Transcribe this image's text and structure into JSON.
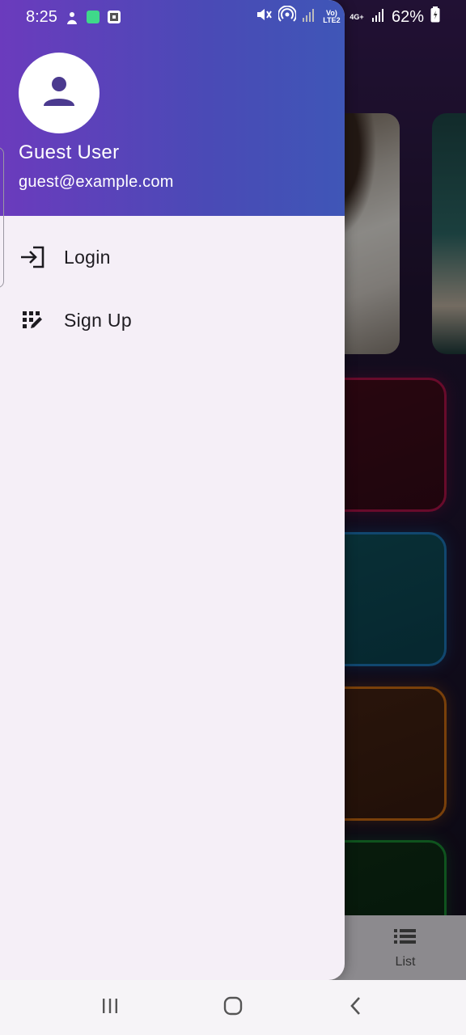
{
  "status_bar": {
    "time": "8:25",
    "battery": "62%",
    "volte_label": "Vo) LTE2",
    "network_label": "4G+"
  },
  "drawer": {
    "user_name": "Guest User",
    "user_email": "guest@example.com",
    "items": [
      {
        "label": "Login",
        "icon": "login-icon"
      },
      {
        "label": "Sign Up",
        "icon": "app-registration-icon"
      }
    ]
  },
  "bottom_nav": {
    "items": [
      {
        "label": "List",
        "icon": "list-icon"
      }
    ]
  },
  "colors": {
    "header_gradient_start": "#6b3bbd",
    "header_gradient_end": "#3f56b7",
    "drawer_bg": "#f5eff7",
    "avatar_icon": "#4b3a8f"
  }
}
